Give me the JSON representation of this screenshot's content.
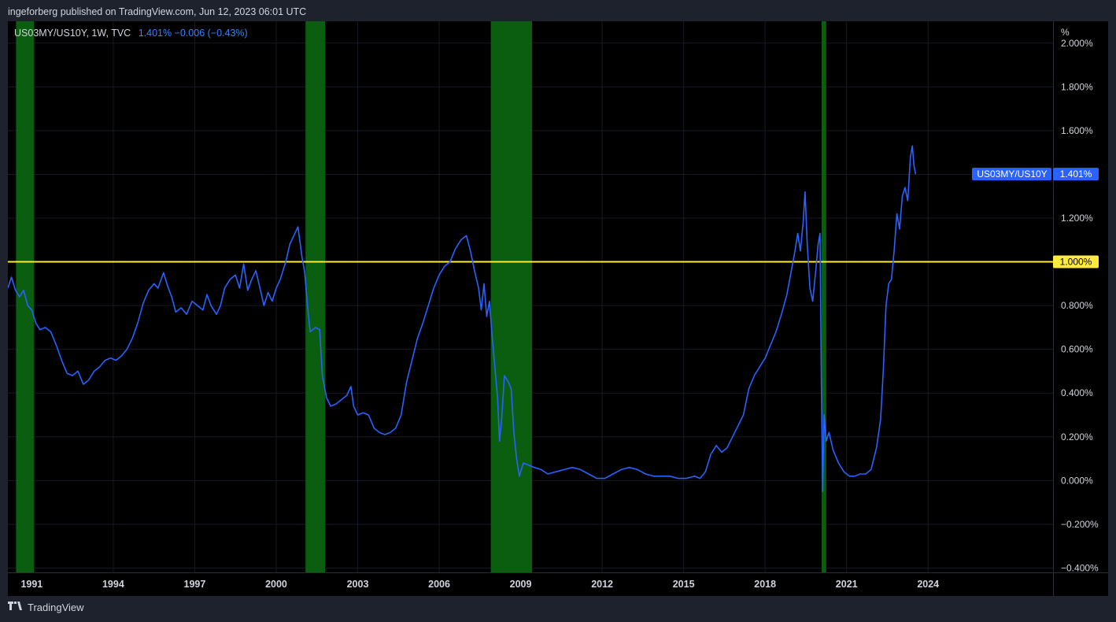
{
  "header": {
    "publisher_text": "ingeforberg published on TradingView.com, Jun 12, 2023 06:01 UTC"
  },
  "legend": {
    "symbol_text": "US03MY/US10Y, 1W, TVC",
    "value_text": "1.401%  −0.006 (−0.43%)"
  },
  "footer": {
    "brand": "TradingView",
    "logo_icon": "tradingview-logo-icon"
  },
  "colors": {
    "background": "#000000",
    "line": "#2962ff",
    "reference": "#ffeb3b",
    "shading": "#0b5e10",
    "panel": "#1e222d"
  },
  "chart_data": {
    "type": "line",
    "x_unit": "year",
    "xlim": [
      1990.12,
      2028.6
    ],
    "ylim": [
      -0.42,
      2.1
    ],
    "y_unit_label": "%",
    "y_ticks": [
      {
        "value": 2.0,
        "label": "2.000%"
      },
      {
        "value": 1.8,
        "label": "1.800%"
      },
      {
        "value": 1.6,
        "label": "1.600%"
      },
      {
        "value": 1.4,
        "label": "1.400%"
      },
      {
        "value": 1.2,
        "label": "1.200%"
      },
      {
        "value": 1.0,
        "label": "1.000%"
      },
      {
        "value": 0.8,
        "label": "0.800%"
      },
      {
        "value": 0.6,
        "label": "0.600%"
      },
      {
        "value": 0.4,
        "label": "0.400%"
      },
      {
        "value": 0.2,
        "label": "0.200%"
      },
      {
        "value": 0.0,
        "label": "0.000%"
      },
      {
        "value": -0.2,
        "label": "−0.200%"
      },
      {
        "value": -0.4,
        "label": "−0.400%"
      }
    ],
    "x_ticks": [
      {
        "value": 1991,
        "label": "1991"
      },
      {
        "value": 1994,
        "label": "1994"
      },
      {
        "value": 1997,
        "label": "1997"
      },
      {
        "value": 2000,
        "label": "2000"
      },
      {
        "value": 2003,
        "label": "2003"
      },
      {
        "value": 2006,
        "label": "2006"
      },
      {
        "value": 2009,
        "label": "2009"
      },
      {
        "value": 2012,
        "label": "2012"
      },
      {
        "value": 2015,
        "label": "2015"
      },
      {
        "value": 2018,
        "label": "2018"
      },
      {
        "value": 2021,
        "label": "2021"
      },
      {
        "value": 2024,
        "label": "2024"
      }
    ],
    "shaded_regions": [
      [
        1990.42,
        1991.08
      ],
      [
        2001.08,
        2001.8
      ],
      [
        2007.9,
        2009.42
      ],
      [
        2020.08,
        2020.25
      ]
    ],
    "reference_line": {
      "value": 1.0,
      "label": "1.000%"
    },
    "last_value_label": {
      "series": "US03MY/US10Y",
      "value": 1.401,
      "label": "1.401%"
    },
    "series": [
      {
        "name": "US03MY/US10Y",
        "points": [
          [
            1990.12,
            0.88
          ],
          [
            1990.25,
            0.93
          ],
          [
            1990.4,
            0.87
          ],
          [
            1990.55,
            0.84
          ],
          [
            1990.7,
            0.87
          ],
          [
            1990.85,
            0.8
          ],
          [
            1991.0,
            0.78
          ],
          [
            1991.15,
            0.72
          ],
          [
            1991.3,
            0.69
          ],
          [
            1991.5,
            0.7
          ],
          [
            1991.7,
            0.68
          ],
          [
            1991.9,
            0.62
          ],
          [
            1992.1,
            0.55
          ],
          [
            1992.3,
            0.49
          ],
          [
            1992.5,
            0.48
          ],
          [
            1992.7,
            0.5
          ],
          [
            1992.9,
            0.44
          ],
          [
            1993.1,
            0.46
          ],
          [
            1993.3,
            0.5
          ],
          [
            1993.5,
            0.52
          ],
          [
            1993.7,
            0.55
          ],
          [
            1993.9,
            0.56
          ],
          [
            1994.1,
            0.55
          ],
          [
            1994.3,
            0.57
          ],
          [
            1994.5,
            0.6
          ],
          [
            1994.7,
            0.65
          ],
          [
            1994.9,
            0.72
          ],
          [
            1995.1,
            0.81
          ],
          [
            1995.3,
            0.87
          ],
          [
            1995.5,
            0.9
          ],
          [
            1995.65,
            0.88
          ],
          [
            1995.85,
            0.95
          ],
          [
            1996.0,
            0.89
          ],
          [
            1996.15,
            0.84
          ],
          [
            1996.3,
            0.77
          ],
          [
            1996.5,
            0.79
          ],
          [
            1996.7,
            0.76
          ],
          [
            1996.9,
            0.82
          ],
          [
            1997.1,
            0.8
          ],
          [
            1997.3,
            0.78
          ],
          [
            1997.45,
            0.85
          ],
          [
            1997.6,
            0.8
          ],
          [
            1997.8,
            0.76
          ],
          [
            1997.95,
            0.8
          ],
          [
            1998.1,
            0.88
          ],
          [
            1998.3,
            0.92
          ],
          [
            1998.5,
            0.94
          ],
          [
            1998.65,
            0.88
          ],
          [
            1998.8,
            0.99
          ],
          [
            1998.95,
            0.87
          ],
          [
            1999.1,
            0.92
          ],
          [
            1999.25,
            0.96
          ],
          [
            1999.4,
            0.88
          ],
          [
            1999.55,
            0.8
          ],
          [
            1999.7,
            0.86
          ],
          [
            1999.85,
            0.82
          ],
          [
            2000.0,
            0.88
          ],
          [
            2000.15,
            0.92
          ],
          [
            2000.35,
            1.0
          ],
          [
            2000.5,
            1.08
          ],
          [
            2000.65,
            1.12
          ],
          [
            2000.8,
            1.16
          ],
          [
            2000.95,
            1.02
          ],
          [
            2001.05,
            0.95
          ],
          [
            2001.15,
            0.8
          ],
          [
            2001.25,
            0.68
          ],
          [
            2001.45,
            0.7
          ],
          [
            2001.6,
            0.69
          ],
          [
            2001.7,
            0.48
          ],
          [
            2001.85,
            0.38
          ],
          [
            2002.0,
            0.34
          ],
          [
            2002.2,
            0.35
          ],
          [
            2002.4,
            0.37
          ],
          [
            2002.6,
            0.39
          ],
          [
            2002.75,
            0.43
          ],
          [
            2002.85,
            0.34
          ],
          [
            2003.0,
            0.3
          ],
          [
            2003.2,
            0.31
          ],
          [
            2003.4,
            0.3
          ],
          [
            2003.6,
            0.24
          ],
          [
            2003.8,
            0.22
          ],
          [
            2004.0,
            0.21
          ],
          [
            2004.2,
            0.22
          ],
          [
            2004.4,
            0.24
          ],
          [
            2004.6,
            0.3
          ],
          [
            2004.8,
            0.45
          ],
          [
            2005.0,
            0.55
          ],
          [
            2005.2,
            0.65
          ],
          [
            2005.4,
            0.72
          ],
          [
            2005.6,
            0.8
          ],
          [
            2005.8,
            0.88
          ],
          [
            2006.0,
            0.94
          ],
          [
            2006.2,
            0.98
          ],
          [
            2006.4,
            1.0
          ],
          [
            2006.6,
            1.06
          ],
          [
            2006.8,
            1.1
          ],
          [
            2007.0,
            1.12
          ],
          [
            2007.15,
            1.05
          ],
          [
            2007.3,
            0.96
          ],
          [
            2007.45,
            0.88
          ],
          [
            2007.55,
            0.78
          ],
          [
            2007.65,
            0.9
          ],
          [
            2007.75,
            0.75
          ],
          [
            2007.85,
            0.82
          ],
          [
            2007.95,
            0.66
          ],
          [
            2008.05,
            0.52
          ],
          [
            2008.15,
            0.38
          ],
          [
            2008.22,
            0.18
          ],
          [
            2008.3,
            0.28
          ],
          [
            2008.4,
            0.48
          ],
          [
            2008.55,
            0.45
          ],
          [
            2008.65,
            0.42
          ],
          [
            2008.75,
            0.22
          ],
          [
            2008.85,
            0.1
          ],
          [
            2008.95,
            0.02
          ],
          [
            2009.1,
            0.08
          ],
          [
            2009.3,
            0.07
          ],
          [
            2009.5,
            0.06
          ],
          [
            2009.75,
            0.05
          ],
          [
            2010.0,
            0.03
          ],
          [
            2010.3,
            0.04
          ],
          [
            2010.6,
            0.05
          ],
          [
            2010.9,
            0.06
          ],
          [
            2011.2,
            0.05
          ],
          [
            2011.5,
            0.03
          ],
          [
            2011.8,
            0.01
          ],
          [
            2012.1,
            0.01
          ],
          [
            2012.4,
            0.03
          ],
          [
            2012.7,
            0.05
          ],
          [
            2013.0,
            0.06
          ],
          [
            2013.3,
            0.05
          ],
          [
            2013.6,
            0.03
          ],
          [
            2013.9,
            0.02
          ],
          [
            2014.2,
            0.02
          ],
          [
            2014.5,
            0.02
          ],
          [
            2014.8,
            0.01
          ],
          [
            2015.1,
            0.01
          ],
          [
            2015.4,
            0.02
          ],
          [
            2015.6,
            0.01
          ],
          [
            2015.8,
            0.04
          ],
          [
            2016.0,
            0.12
          ],
          [
            2016.2,
            0.16
          ],
          [
            2016.4,
            0.13
          ],
          [
            2016.6,
            0.15
          ],
          [
            2016.8,
            0.2
          ],
          [
            2017.0,
            0.25
          ],
          [
            2017.2,
            0.3
          ],
          [
            2017.4,
            0.42
          ],
          [
            2017.6,
            0.48
          ],
          [
            2017.8,
            0.52
          ],
          [
            2018.0,
            0.56
          ],
          [
            2018.2,
            0.62
          ],
          [
            2018.4,
            0.68
          ],
          [
            2018.6,
            0.76
          ],
          [
            2018.8,
            0.85
          ],
          [
            2018.95,
            0.95
          ],
          [
            2019.1,
            1.05
          ],
          [
            2019.2,
            1.13
          ],
          [
            2019.3,
            1.05
          ],
          [
            2019.4,
            1.18
          ],
          [
            2019.47,
            1.32
          ],
          [
            2019.55,
            1.08
          ],
          [
            2019.65,
            0.88
          ],
          [
            2019.75,
            0.82
          ],
          [
            2019.85,
            0.94
          ],
          [
            2019.95,
            1.08
          ],
          [
            2020.02,
            1.13
          ],
          [
            2020.07,
            0.45
          ],
          [
            2020.12,
            -0.05
          ],
          [
            2020.17,
            0.3
          ],
          [
            2020.25,
            0.18
          ],
          [
            2020.35,
            0.22
          ],
          [
            2020.5,
            0.14
          ],
          [
            2020.7,
            0.08
          ],
          [
            2020.9,
            0.04
          ],
          [
            2021.1,
            0.02
          ],
          [
            2021.3,
            0.02
          ],
          [
            2021.5,
            0.03
          ],
          [
            2021.7,
            0.03
          ],
          [
            2021.9,
            0.05
          ],
          [
            2022.1,
            0.15
          ],
          [
            2022.25,
            0.28
          ],
          [
            2022.35,
            0.5
          ],
          [
            2022.45,
            0.8
          ],
          [
            2022.55,
            0.9
          ],
          [
            2022.65,
            0.92
          ],
          [
            2022.75,
            1.05
          ],
          [
            2022.85,
            1.22
          ],
          [
            2022.95,
            1.15
          ],
          [
            2023.05,
            1.3
          ],
          [
            2023.15,
            1.34
          ],
          [
            2023.25,
            1.28
          ],
          [
            2023.35,
            1.48
          ],
          [
            2023.42,
            1.53
          ],
          [
            2023.48,
            1.44
          ],
          [
            2023.54,
            1.401
          ]
        ]
      }
    ]
  }
}
